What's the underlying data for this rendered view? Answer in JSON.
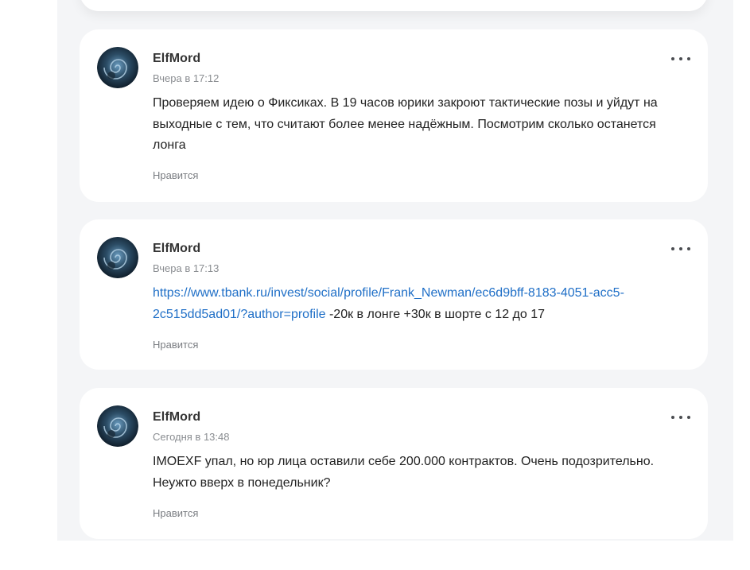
{
  "posts": [
    {
      "author": "ElfMord",
      "time": "Вчера в 17:12",
      "text": "Проверяем идею о Фиксиках. В 19 часов юрики закроют тактические позы и уйдут на выходные с тем, что считают более менее надёжным. Посмотрим сколько останется лонга",
      "like_label": "Нравится"
    },
    {
      "author": "ElfMord",
      "time": "Вчера в 17:13",
      "link": "https://www.tbank.ru/invest/social/profile/Frank_Newman/ec6d9bff-8183-4051-acc5-2c515dd5ad01/?author=profile",
      "text": " -20к в лонге +30к в шорте с 12 до 17",
      "like_label": "Нравится"
    },
    {
      "author": "ElfMord",
      "time": "Сегодня в 13:48",
      "text": "IMOEXF упал, но юр лица оставили себе 200.000 контрактов. Очень подозрительно. Неужто вверх в понедельник?",
      "like_label": "Нравится"
    }
  ],
  "icons": {
    "menu": "more-dots-icon",
    "avatar": "fractal-spiral-avatar"
  }
}
